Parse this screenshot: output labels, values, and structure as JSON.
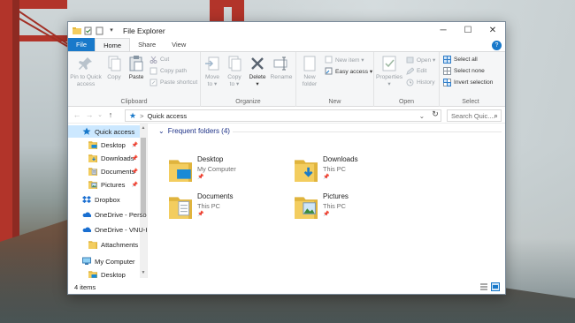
{
  "window": {
    "title": "File Explorer",
    "minimize": "─",
    "maximize": "☐",
    "close": "✕"
  },
  "tabs": [
    {
      "label": "File"
    },
    {
      "label": "Home"
    },
    {
      "label": "Share"
    },
    {
      "label": "View"
    }
  ],
  "help": "?",
  "ribbon": {
    "clipboard": {
      "label": "Clipboard",
      "pin": [
        "Pin to Quick",
        "access"
      ],
      "copy": "Copy",
      "paste": "Paste",
      "cut": "Cut",
      "copy_path": "Copy path",
      "paste_shortcut": "Paste shortcut"
    },
    "organize": {
      "label": "Organize",
      "move_to": [
        "Move",
        "to ▾"
      ],
      "copy_to": [
        "Copy",
        "to ▾"
      ],
      "delete": [
        "Delete",
        "▾"
      ],
      "rename": "Rename"
    },
    "new": {
      "label": "New",
      "new_folder": [
        "New",
        "folder"
      ],
      "new_item": "New item ▾",
      "easy_access": "Easy access ▾"
    },
    "open": {
      "label": "Open",
      "properties": [
        "Properties",
        "▾"
      ],
      "open": "Open ▾",
      "edit": "Edit",
      "history": "History"
    },
    "select": {
      "label": "Select",
      "select_all": "Select all",
      "select_none": "Select none",
      "invert": "Invert selection"
    }
  },
  "address": {
    "back": "←",
    "forward": "→",
    "recent": "⌄",
    "up": "↑",
    "path": "Quick access",
    "chevron": ">",
    "dropdown": "⌄",
    "refresh": "↻",
    "search_placeholder": "Search Quic...",
    "search_icon": "⌕"
  },
  "nav": [
    {
      "label": "Quick access",
      "icon": "star-icon",
      "selected": true,
      "pinned": false
    },
    {
      "label": "Desktop",
      "icon": "desktop-folder-icon",
      "pinned": true
    },
    {
      "label": "Downloads",
      "icon": "downloads-folder-icon",
      "pinned": true
    },
    {
      "label": "Documents",
      "icon": "documents-folder-icon",
      "pinned": true
    },
    {
      "label": "Pictures",
      "icon": "pictures-folder-icon",
      "pinned": true
    },
    {
      "label": "Dropbox",
      "icon": "dropbox-icon"
    },
    {
      "label": "OneDrive - Person",
      "icon": "onedrive-icon"
    },
    {
      "label": "OneDrive - VNU-H",
      "icon": "onedrive-icon"
    },
    {
      "label": "Attachments",
      "icon": "folder-icon"
    },
    {
      "label": "My Computer",
      "icon": "computer-icon"
    },
    {
      "label": "Desktop",
      "icon": "desktop-folder-icon"
    }
  ],
  "pin_glyph": "📌",
  "section": {
    "title": "Frequent folders (4)",
    "chevron": "⌄"
  },
  "folders": [
    {
      "name": "Desktop",
      "location": "My Computer",
      "pin": "📌",
      "icon": "desktop-folder-icon"
    },
    {
      "name": "Downloads",
      "location": "This PC",
      "pin": "📌",
      "icon": "downloads-folder-icon"
    },
    {
      "name": "Documents",
      "location": "This PC",
      "pin": "📌",
      "icon": "documents-folder-icon"
    },
    {
      "name": "Pictures",
      "location": "This PC",
      "pin": "📌",
      "icon": "pictures-folder-icon"
    }
  ],
  "status": {
    "count": "4 items"
  },
  "colors": {
    "accent": "#1979ca",
    "selection": "#cce8ff",
    "folder": "#f3cd5f",
    "section_title": "#1e3287"
  }
}
